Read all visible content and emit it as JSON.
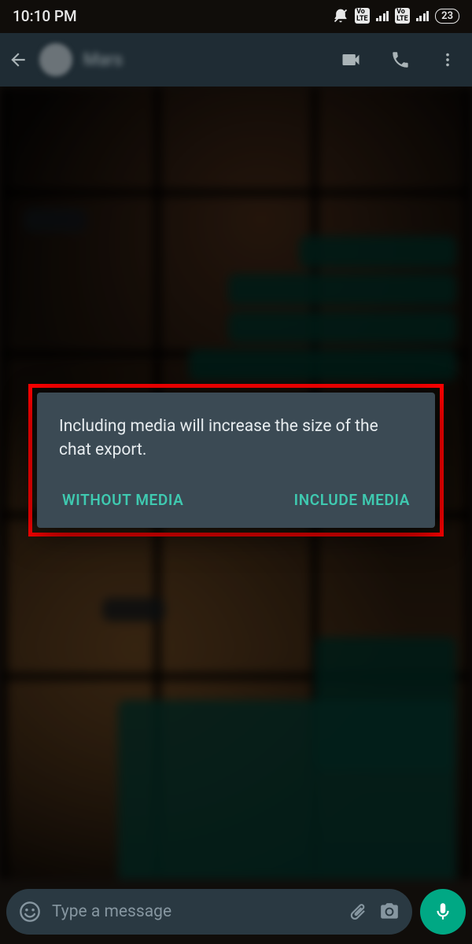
{
  "status": {
    "time": "10:10 PM",
    "battery": "23"
  },
  "header": {
    "contact_name": "Mars"
  },
  "dialog": {
    "message": "Including media will increase the size of the chat export.",
    "without_media": "WITHOUT MEDIA",
    "include_media": "INCLUDE MEDIA"
  },
  "input": {
    "placeholder": "Type a message"
  }
}
